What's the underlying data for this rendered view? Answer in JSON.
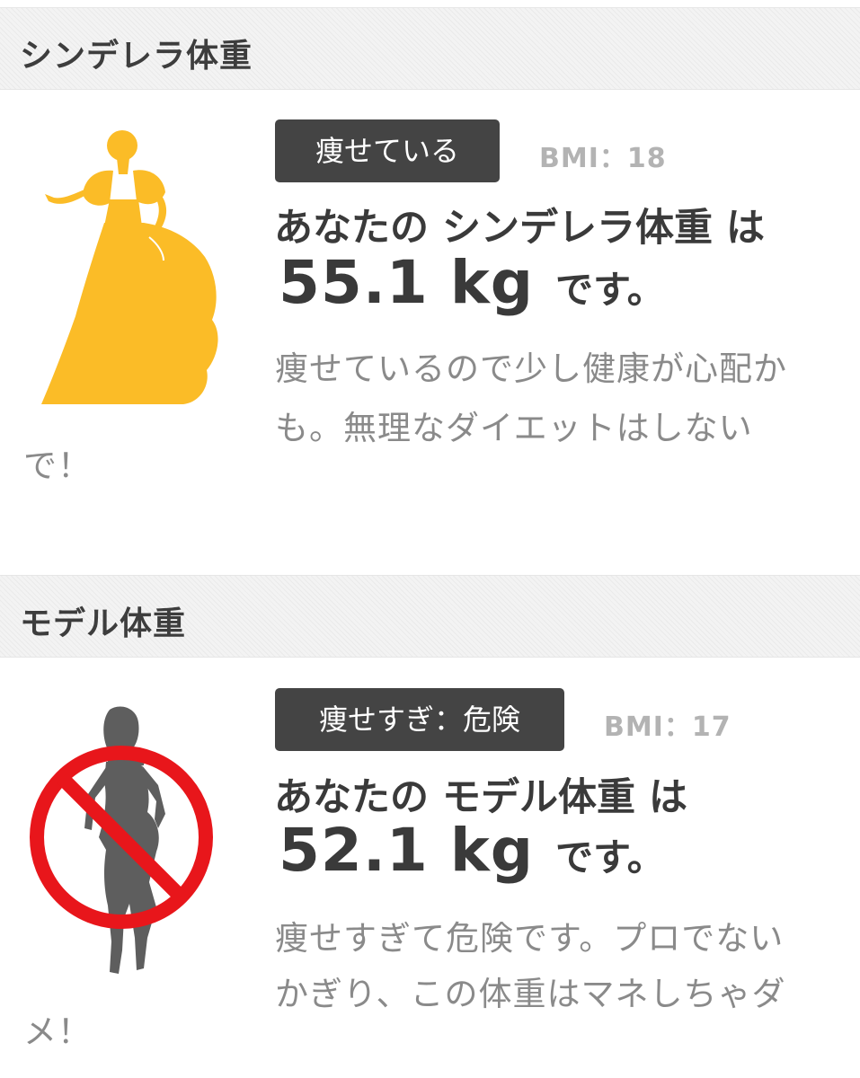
{
  "cinderella": {
    "title": "シンデレラ体重",
    "badge": "痩せている",
    "bmi": "BMI：18",
    "result_line": "あなたの シンデレラ体重 は",
    "weight": "55.1 kg",
    "suffix": "です。",
    "advice_lines": [
      "痩せているので少し健康が心配か",
      "も。無理なダイエットはしない",
      "で！"
    ],
    "icon": "cinderella-silhouette-icon",
    "silhouette_color": "#FBBC27"
  },
  "model": {
    "title": "モデル体重",
    "badge": "痩せすぎ：危険",
    "bmi": "BMI：17",
    "result_line": "あなたの モデル体重 は",
    "weight": "52.1 kg",
    "suffix": "です。",
    "advice_lines": [
      "痩せすぎて危険です。プロでない",
      "かぎり、この体重はマネしちゃダ",
      "メ！"
    ],
    "icon": "model-prohibited-icon",
    "silhouette_color": "#5E5E5E",
    "prohibition_color": "#E8161B"
  }
}
